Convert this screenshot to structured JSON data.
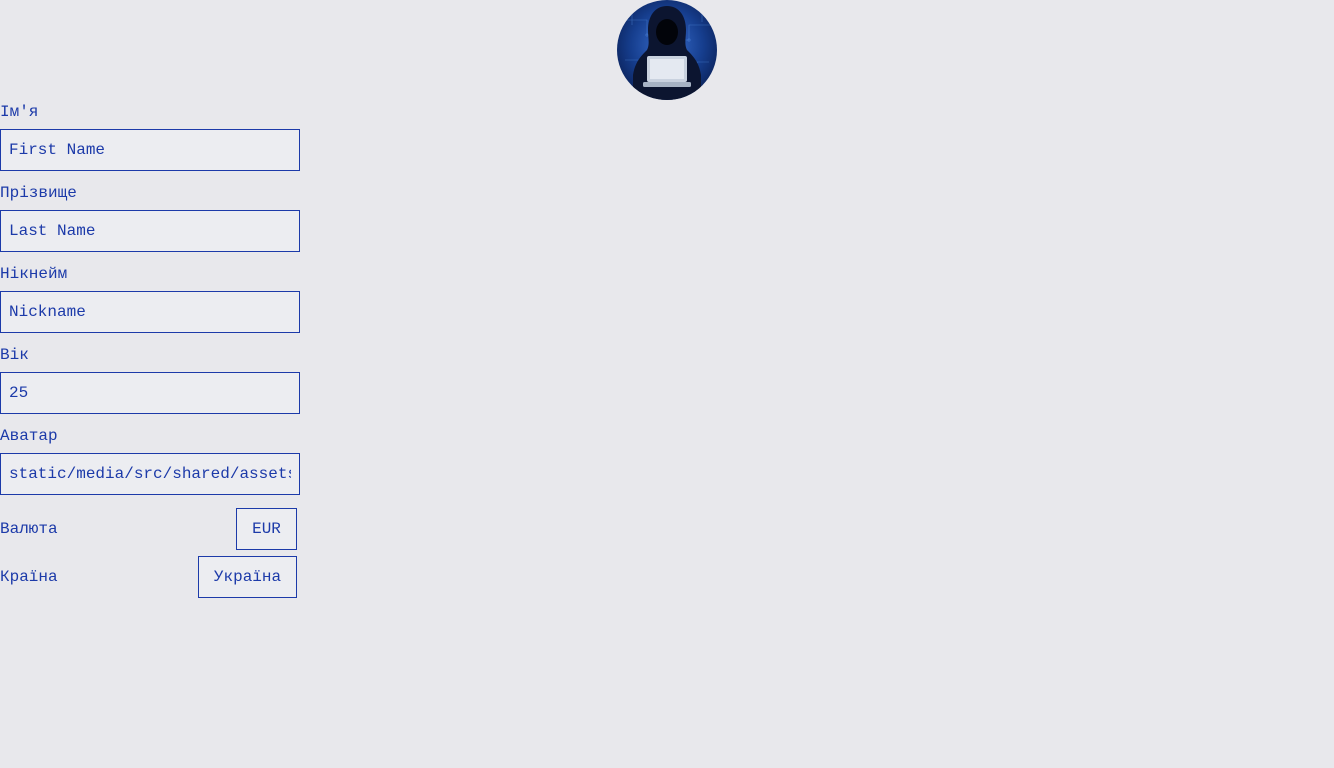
{
  "profile": {
    "avatar_alt": "hooded-hacker-avatar"
  },
  "form": {
    "first_name": {
      "label": "Ім'я",
      "placeholder": "First Name",
      "value": ""
    },
    "last_name": {
      "label": "Прізвище",
      "placeholder": "Last Name",
      "value": ""
    },
    "nickname": {
      "label": "Нікнейм",
      "placeholder": "Nickname",
      "value": ""
    },
    "age": {
      "label": "Вік",
      "placeholder": "",
      "value": "25"
    },
    "avatar": {
      "label": "Аватар",
      "placeholder": "",
      "value": "static/media/src/shared/assets"
    },
    "currency": {
      "label": "Валюта",
      "value": "EUR"
    },
    "country": {
      "label": "Країна",
      "value": "Україна"
    }
  },
  "colors": {
    "accent": "#1c3aa9",
    "background": "#e8e8ec"
  }
}
